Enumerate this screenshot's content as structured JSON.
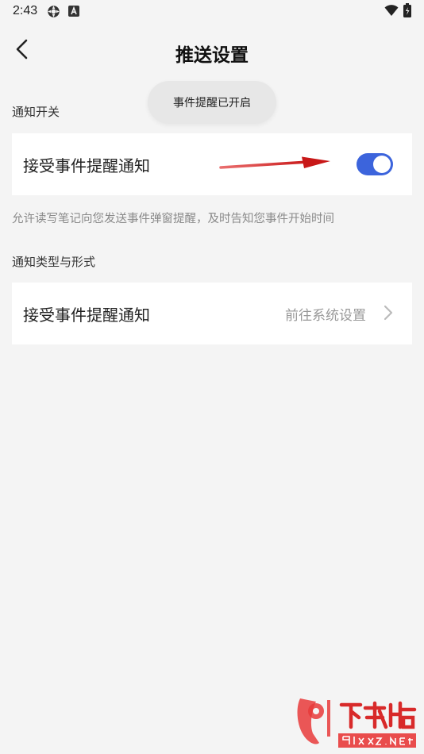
{
  "status_bar": {
    "time": "2:43",
    "icons": [
      "settings-gear-icon",
      "a-badge-icon",
      "wifi-icon",
      "battery-icon"
    ]
  },
  "header": {
    "title": "推送设置",
    "back_icon": "chevron-left-icon"
  },
  "toast": {
    "text": "事件提醒已开启"
  },
  "section_notify_switch": {
    "label": "通知开关",
    "row_title": "接受事件提醒通知",
    "toggle_on": true,
    "description": "允许读写笔记向您发送事件弹窗提醒，及时告知您事件开始时间"
  },
  "section_notify_type": {
    "label": "通知类型与形式",
    "row_title": "接受事件提醒通知",
    "row_value": "前往系统设置"
  },
  "colors": {
    "accent": "#3c64dc",
    "background": "#f4f4f4",
    "arrow_annotation": "#d32020"
  }
}
